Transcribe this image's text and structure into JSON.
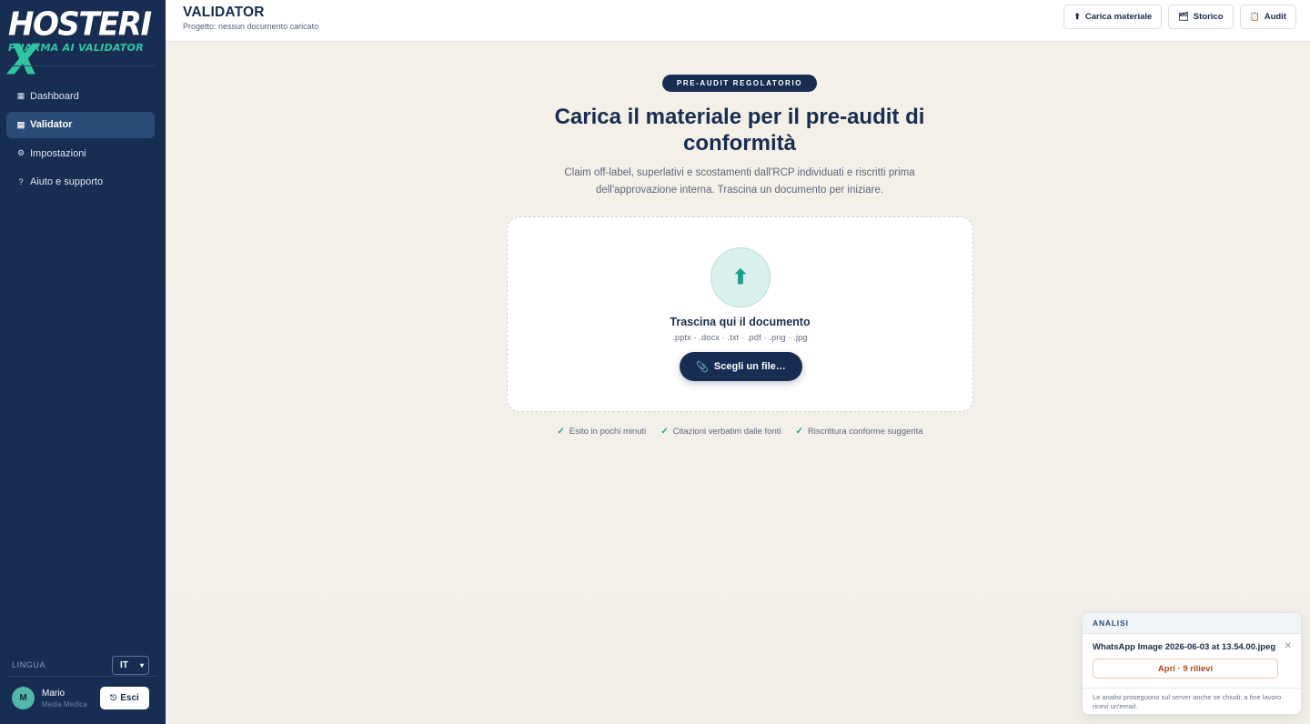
{
  "brand": {
    "name": "HOSTERI",
    "x": "X",
    "tagline": "PHARMA AI VALIDATOR"
  },
  "sidebar": {
    "items": [
      {
        "label": "Dashboard",
        "icon": "▦"
      },
      {
        "label": "Validator",
        "icon": "▤"
      },
      {
        "label": "Impostazioni",
        "icon": "⚙"
      },
      {
        "label": "Aiuto e supporto",
        "icon": "?"
      }
    ],
    "language_label": "LINGUA",
    "language_value": "IT",
    "user_initial": "M",
    "user_name": "Mario",
    "user_role": "Media Medica",
    "logout_label": "Esci"
  },
  "header": {
    "title": "VALIDATOR",
    "subtitle": "Progetto: nessun documento caricato",
    "actions": [
      {
        "label": "Carica materiale",
        "icon": "⬆"
      },
      {
        "label": "Storico",
        "icon": "🗂"
      },
      {
        "label": "Audit",
        "icon": "📋"
      }
    ]
  },
  "main": {
    "badge": "PRE-AUDIT REGOLATORIO",
    "title": "Carica il materiale per il pre-audit di conformità",
    "subtitle": "Claim off-label, superlativi e scostamenti dall'RCP individuati e riscritti prima dell'approvazione interna. Trascina un documento per iniziare.",
    "dropzone": {
      "title": "Trascina qui il documento",
      "formats": ".pptx · .docx · .txt · .pdf · .png · .jpg",
      "button": "Scegli un file…"
    },
    "features": [
      "Esito in pochi minuti",
      "Citazioni verbatim dalle fonti",
      "Riscrittura conforme suggerita"
    ]
  },
  "analysis_panel": {
    "header": "ANALISI",
    "file_name": "WhatsApp Image 2026-06-03 at 13.54.00.jpeg",
    "open_label": "Apri · 9 rilievi",
    "note": "Le analisi proseguono sul server anche se chiudi: a fine lavoro ricevi un'email."
  },
  "colors": {
    "sidebar_bg": "#172d52",
    "accent": "#2fc5a0",
    "warning": "#b24a1d"
  }
}
